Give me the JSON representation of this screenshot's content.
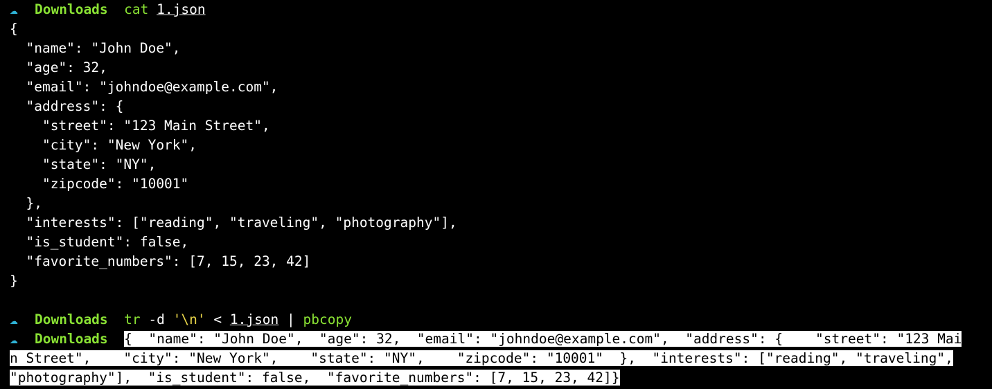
{
  "prompt": {
    "arrow": "☁",
    "cwd": "Downloads"
  },
  "commands": [
    {
      "name": "cat",
      "args": "1.json"
    },
    {
      "name": "tr",
      "flag": "-d",
      "quoted": "'\\n'",
      "redirect": "<",
      "file": "1.json",
      "pipe": "|",
      "pipe_cmd": "pbcopy"
    }
  ],
  "json_output": [
    "{",
    "  \"name\": \"John Doe\",",
    "  \"age\": 32,",
    "  \"email\": \"johndoe@example.com\",",
    "  \"address\": {",
    "    \"street\": \"123 Main Street\",",
    "    \"city\": \"New York\",",
    "    \"state\": \"NY\",",
    "    \"zipcode\": \"10001\"",
    "  },",
    "  \"interests\": [\"reading\", \"traveling\", \"photography\"],",
    "  \"is_student\": false,",
    "  \"favorite_numbers\": [7, 15, 23, 42]",
    "}"
  ],
  "pasted_line_1": "{  \"name\": \"John Doe\",  \"age\": 32,  \"email\": \"johndoe@example.com\",  \"address\": {    \"street\": \"123 Mai",
  "pasted_line_2": "n Street\",    \"city\": \"New York\",    \"state\": \"NY\",    \"zipcode\": \"10001\"  },  \"interests\": [\"reading\", \"traveling\",",
  "pasted_line_3": "\"photography\"],  \"is_student\": false,  \"favorite_numbers\": [7, 15, 23, 42]}",
  "colors": {
    "background": "#000000",
    "prompt_arrow": "#2fb3d6",
    "cwd": "#8ae234",
    "string_arg": "#e9d64a",
    "selection_bg": "#ffffff",
    "selection_fg": "#000000"
  }
}
